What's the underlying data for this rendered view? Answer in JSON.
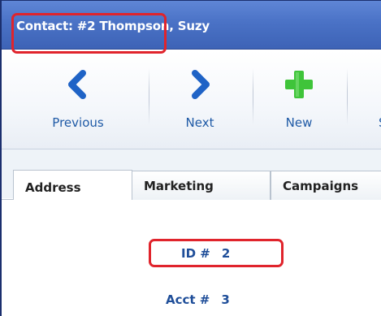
{
  "window": {
    "title": "Contact: #2  Thompson, Suzy"
  },
  "toolbar": {
    "previous_label": "Previous",
    "next_label": "Next",
    "new_label": "New",
    "partial_label": "S"
  },
  "tabs": [
    {
      "label": "Address"
    },
    {
      "label": "Marketing"
    },
    {
      "label": "Campaigns"
    }
  ],
  "fields": {
    "id_label": "ID #",
    "id_value": "2",
    "acct_label": "Acct #",
    "acct_value": "3"
  },
  "colors": {
    "titlebar": "#4a72c6",
    "arrow_blue": "#1f63c6",
    "plus_green": "#3fc43a",
    "label_blue": "#1f5aa6",
    "highlight_red": "#e0242c"
  },
  "icons": [
    "chevron-left-icon",
    "chevron-right-icon",
    "plus-icon"
  ]
}
